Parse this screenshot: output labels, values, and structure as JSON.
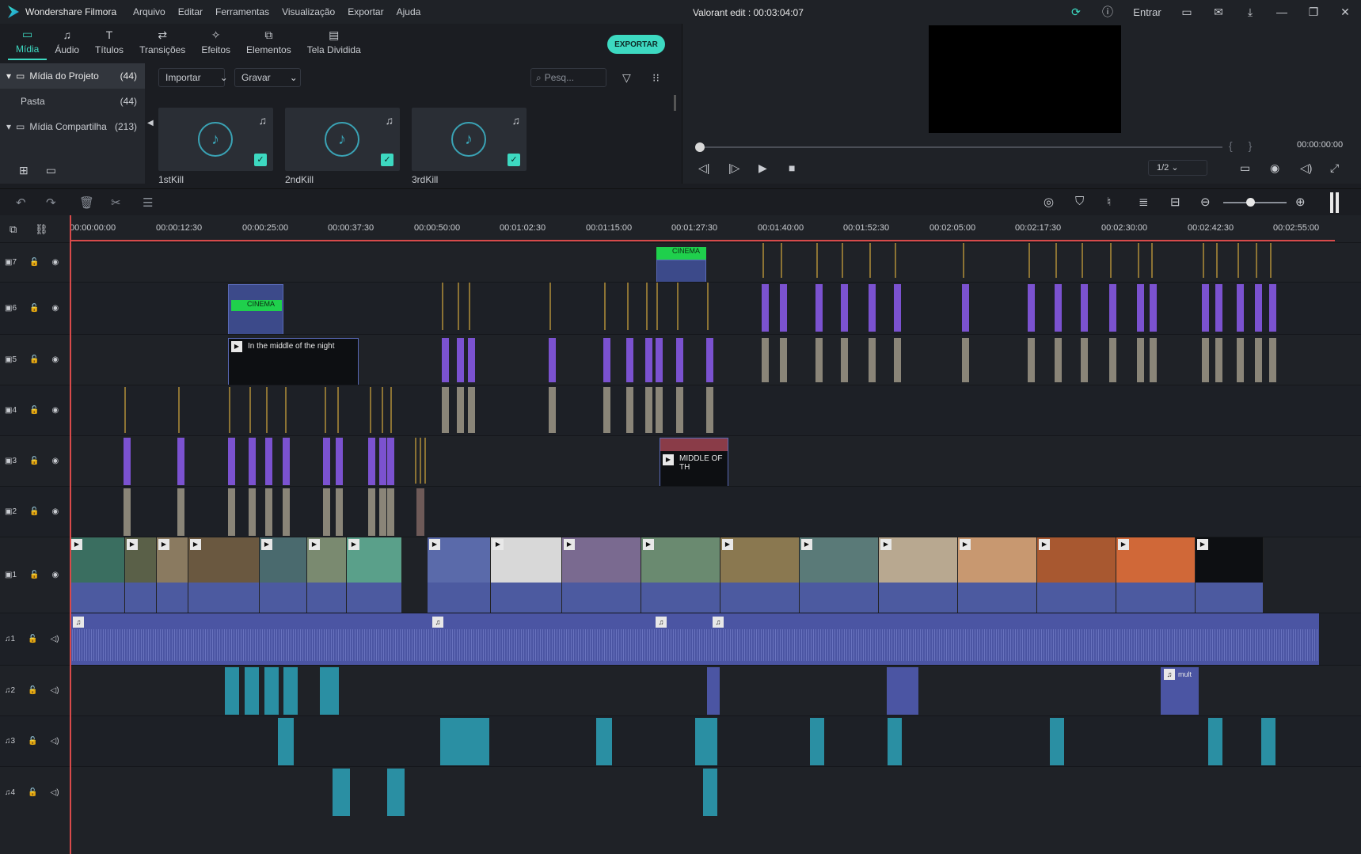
{
  "app": {
    "name": "Wondershare Filmora",
    "project_title": "Valorant edit : 00:03:04:07"
  },
  "menu": [
    "Arquivo",
    "Editar",
    "Ferramentas",
    "Visualização",
    "Exportar",
    "Ajuda"
  ],
  "window": {
    "signin": "Entrar"
  },
  "tabs": [
    {
      "label": "Mídia",
      "icon": "media-folder-icon",
      "active": true
    },
    {
      "label": "Áudio",
      "icon": "music-note-icon"
    },
    {
      "label": "Títulos",
      "icon": "text-t-icon"
    },
    {
      "label": "Transições",
      "icon": "transition-icon"
    },
    {
      "label": "Efeitos",
      "icon": "effects-icon"
    },
    {
      "label": "Elementos",
      "icon": "elements-icon"
    },
    {
      "label": "Tela Dividida",
      "icon": "split-screen-icon"
    }
  ],
  "export_label": "EXPORTAR",
  "sidebar": {
    "items": [
      {
        "label": "Mídia do Projeto",
        "count": "(44)"
      },
      {
        "label": "Pasta",
        "count": "(44)"
      },
      {
        "label": "Mídia Compartilha",
        "count": "(213)"
      }
    ]
  },
  "media": {
    "import_label": "Importar",
    "record_label": "Gravar",
    "search_placeholder": "Pesq...",
    "items": [
      {
        "label": "1stKill"
      },
      {
        "label": "2ndKill"
      },
      {
        "label": "3rdKill"
      }
    ]
  },
  "preview": {
    "time": "00:00:00:00",
    "ratio": "1/2"
  },
  "ruler": {
    "ticks": [
      "00:00:00:00",
      "00:00:12:30",
      "00:00:25:00",
      "00:00:37:30",
      "00:00:50:00",
      "00:01:02:30",
      "00:01:15:00",
      "00:01:27:30",
      "00:01:40:00",
      "00:01:52:30",
      "00:02:05:00",
      "00:02:17:30",
      "00:02:30:00",
      "00:02:42:30",
      "00:02:55:00"
    ]
  },
  "tracks": [
    {
      "label": "7"
    },
    {
      "label": "6"
    },
    {
      "label": "5"
    },
    {
      "label": "4"
    },
    {
      "label": "3"
    },
    {
      "label": "2"
    },
    {
      "label": "1"
    },
    {
      "label": "1"
    },
    {
      "label": "2"
    },
    {
      "label": "3"
    },
    {
      "label": "4"
    }
  ],
  "clips": {
    "cinema_1": "CINEMA",
    "cinema_2": "CINEMA",
    "title_clip": "In the middle of the night",
    "middle_clip": "MIDDLE OF TH",
    "audio_1": "mult"
  },
  "colors": {
    "accent": "#3dd9c1",
    "playhead": "#d84a4a",
    "clip_blue": "#4b55a3",
    "clip_purple": "#7b52d0",
    "audio_teal": "#2a8fa3"
  }
}
